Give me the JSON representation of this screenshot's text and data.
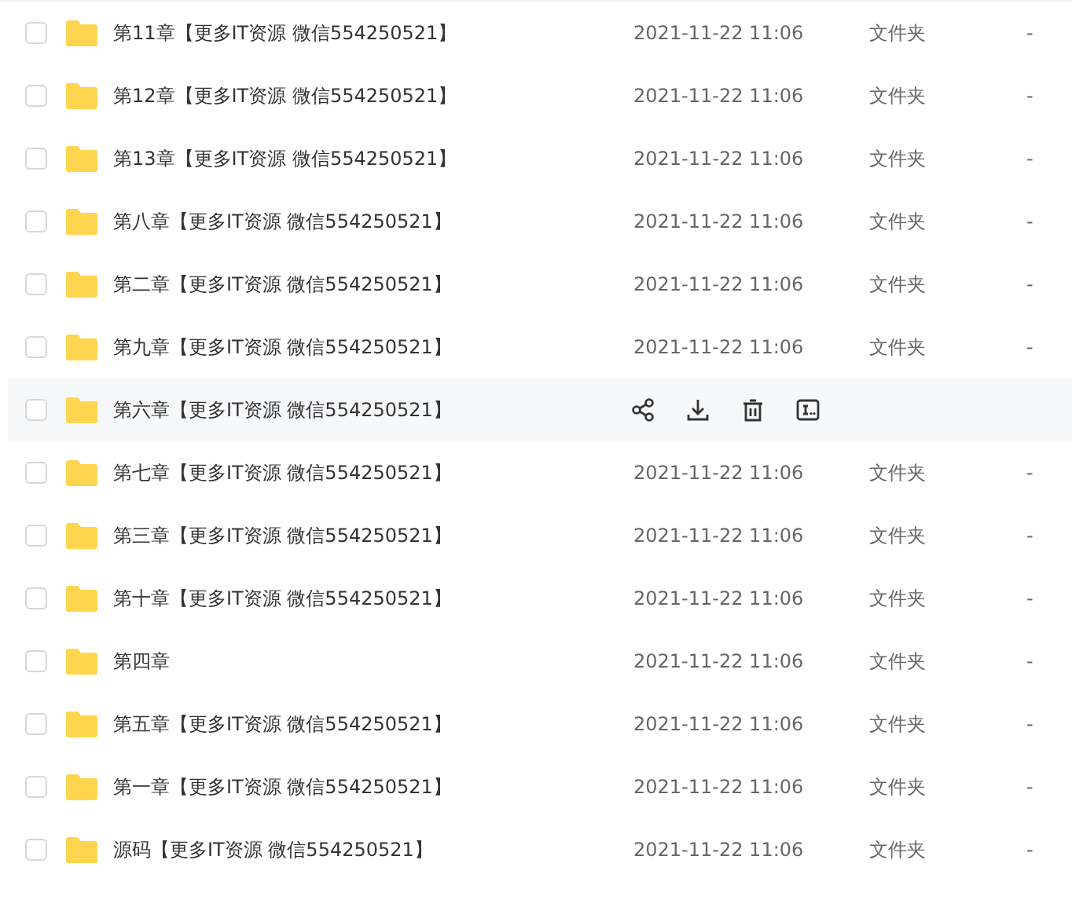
{
  "rows": [
    {
      "name": "第11章【更多IT资源 微信554250521】",
      "modified": "2021-11-22 11:06",
      "type": "文件夹",
      "size": "-",
      "checked": false,
      "hovered": false
    },
    {
      "name": "第12章【更多IT资源 微信554250521】",
      "modified": "2021-11-22 11:06",
      "type": "文件夹",
      "size": "-",
      "checked": false,
      "hovered": false
    },
    {
      "name": "第13章【更多IT资源 微信554250521】",
      "modified": "2021-11-22 11:06",
      "type": "文件夹",
      "size": "-",
      "checked": false,
      "hovered": false
    },
    {
      "name": "第八章【更多IT资源 微信554250521】",
      "modified": "2021-11-22 11:06",
      "type": "文件夹",
      "size": "-",
      "checked": false,
      "hovered": false
    },
    {
      "name": "第二章【更多IT资源 微信554250521】",
      "modified": "2021-11-22 11:06",
      "type": "文件夹",
      "size": "-",
      "checked": false,
      "hovered": false
    },
    {
      "name": "第九章【更多IT资源 微信554250521】",
      "modified": "2021-11-22 11:06",
      "type": "文件夹",
      "size": "-",
      "checked": false,
      "hovered": false
    },
    {
      "name": "第六章【更多IT资源 微信554250521】",
      "checked": false,
      "hovered": true
    },
    {
      "name": "第七章【更多IT资源 微信554250521】",
      "modified": "2021-11-22 11:06",
      "type": "文件夹",
      "size": "-",
      "checked": false,
      "hovered": false
    },
    {
      "name": "第三章【更多IT资源 微信554250521】",
      "modified": "2021-11-22 11:06",
      "type": "文件夹",
      "size": "-",
      "checked": false,
      "hovered": false
    },
    {
      "name": "第十章【更多IT资源 微信554250521】",
      "modified": "2021-11-22 11:06",
      "type": "文件夹",
      "size": "-",
      "checked": false,
      "hovered": false
    },
    {
      "name": "第四章",
      "modified": "2021-11-22 11:06",
      "type": "文件夹",
      "size": "-",
      "checked": false,
      "hovered": false
    },
    {
      "name": "第五章【更多IT资源 微信554250521】",
      "modified": "2021-11-22 11:06",
      "type": "文件夹",
      "size": "-",
      "checked": false,
      "hovered": false
    },
    {
      "name": "第一章【更多IT资源 微信554250521】",
      "modified": "2021-11-22 11:06",
      "type": "文件夹",
      "size": "-",
      "checked": false,
      "hovered": false
    },
    {
      "name": "源码【更多IT资源 微信554250521】",
      "modified": "2021-11-22 11:06",
      "type": "文件夹",
      "size": "-",
      "checked": false,
      "hovered": false
    }
  ]
}
